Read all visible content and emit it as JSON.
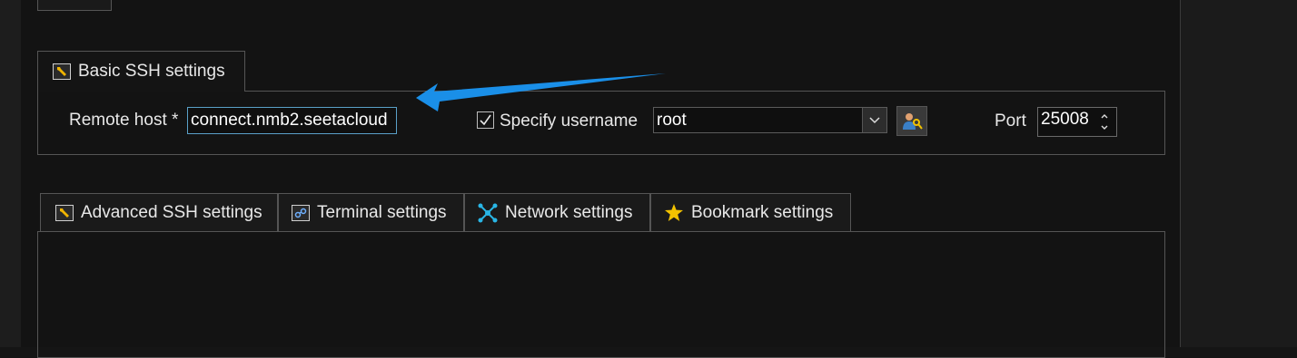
{
  "basic_tab": {
    "label": "Basic SSH settings",
    "icon": "wrench-icon"
  },
  "remote_host": {
    "label": "Remote host *",
    "value": "connect.nmb2.seetacloud"
  },
  "specify_username": {
    "label": "Specify username",
    "checked": true,
    "value": "root"
  },
  "port": {
    "label": "Port",
    "value": "25008"
  },
  "lower_tabs": [
    {
      "label": "Advanced SSH settings",
      "icon": "wrench-icon"
    },
    {
      "label": "Terminal settings",
      "icon": "terminal-icon"
    },
    {
      "label": "Network settings",
      "icon": "network-icon"
    },
    {
      "label": "Bookmark settings",
      "icon": "star-icon"
    }
  ],
  "colors": {
    "arrow": "#1a8fe8",
    "background": "#131313",
    "border": "#555555",
    "star": "#f2c200",
    "network": "#29b6e6"
  }
}
